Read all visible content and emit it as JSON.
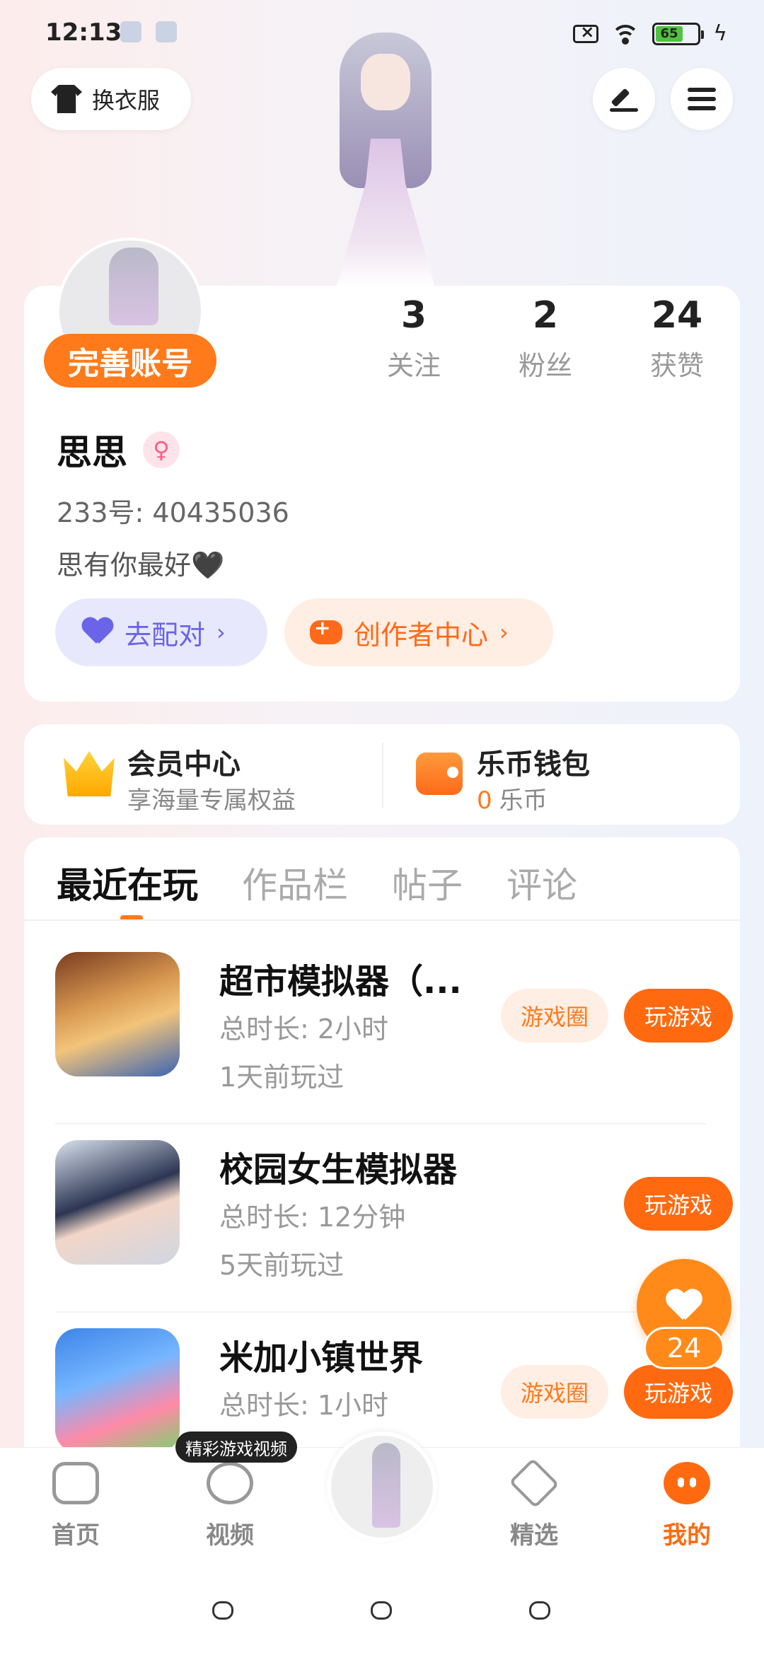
{
  "status_bar": {
    "time": "12:13",
    "battery": "65"
  },
  "top": {
    "outfit_label": "换衣服"
  },
  "profile": {
    "complete_account": "完善账号",
    "stats": [
      {
        "num": "3",
        "label": "关注"
      },
      {
        "num": "2",
        "label": "粉丝"
      },
      {
        "num": "24",
        "label": "获赞"
      }
    ],
    "name": "思思",
    "gender_symbol": "♀",
    "uid": "233号: 40435036",
    "bio": "思有你最好🖤",
    "pair_label": "去配对",
    "creator_label": "创作者中心"
  },
  "member": {
    "title": "会员中心",
    "subtitle": "享海量专属权益",
    "wallet_title": "乐币钱包",
    "wallet_amount": "0",
    "wallet_unit": "乐币"
  },
  "tabs": [
    "最近在玩",
    "作品栏",
    "帖子",
    "评论"
  ],
  "games": [
    {
      "title": "超市模拟器（...",
      "duration": "总时长: 2小时",
      "last": "1天前玩过",
      "circle": "游戏圈",
      "play": "玩游戏"
    },
    {
      "title": "校园女生模拟器",
      "duration": "总时长: 12分钟",
      "last": "5天前玩过",
      "play": "玩游戏"
    },
    {
      "title": "米加小镇世界",
      "duration": "总时长: 1小时",
      "circle": "游戏圈",
      "play": "玩游戏"
    }
  ],
  "fab": {
    "count": "24"
  },
  "tooltip": "精彩游戏视频",
  "nav": [
    {
      "label": "首页"
    },
    {
      "label": "视频"
    },
    {
      "label": "精选"
    },
    {
      "label": "我的"
    }
  ],
  "colors": {
    "accent": "#ff6a10",
    "pair": "#6a65e8"
  }
}
